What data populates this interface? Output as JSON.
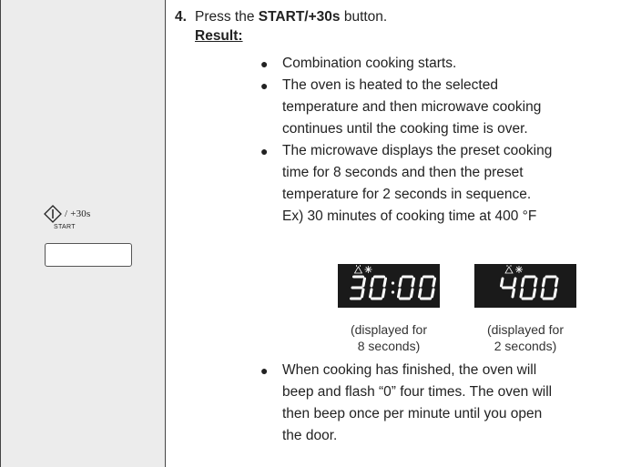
{
  "step": {
    "number": "4.",
    "pre": "Press the ",
    "button_name": "START/+30s",
    "post": " button."
  },
  "result_label": "Result:",
  "bullets": [
    "Combination cooking starts.",
    "The oven is heated to the selected temperature and then microwave cooking continues until the cooking time is over.",
    "The microwave displays the preset cooking time for 8 seconds and then the preset temperature for 2 seconds in sequence. Ex) 30 minutes of cooking time at 400 °F",
    "When cooking has finished, the oven will beep and flash “0” four times. The oven will then beep once per minute until you open the door."
  ],
  "bullet_lines": [
    [
      "Combination cooking starts."
    ],
    [
      "The oven is heated to the selected",
      "temperature and then microwave cooking",
      "continues until the cooking time is over."
    ],
    [
      "The microwave displays the preset cooking",
      "time for 8 seconds and then the preset",
      "temperature for 2 seconds in sequence.",
      "Ex) 30 minutes of cooking time at 400 °F"
    ],
    [
      "When cooking has finished, the oven will",
      "beep and flash “0” four times. The oven will",
      "then beep once per minute until you open",
      "the door."
    ]
  ],
  "start_button": {
    "suffix": "/ +30s",
    "sub_label": "START"
  },
  "displays": [
    {
      "value": "30:00",
      "caption_lines": [
        "(displayed for",
        "8 seconds)"
      ]
    },
    {
      "value": "400",
      "caption_lines": [
        "(displayed for",
        "2 seconds)"
      ]
    }
  ],
  "colors": {
    "left_panel": "#ececec",
    "display_bg": "#1a1a1a",
    "segment": "#ffffff"
  }
}
